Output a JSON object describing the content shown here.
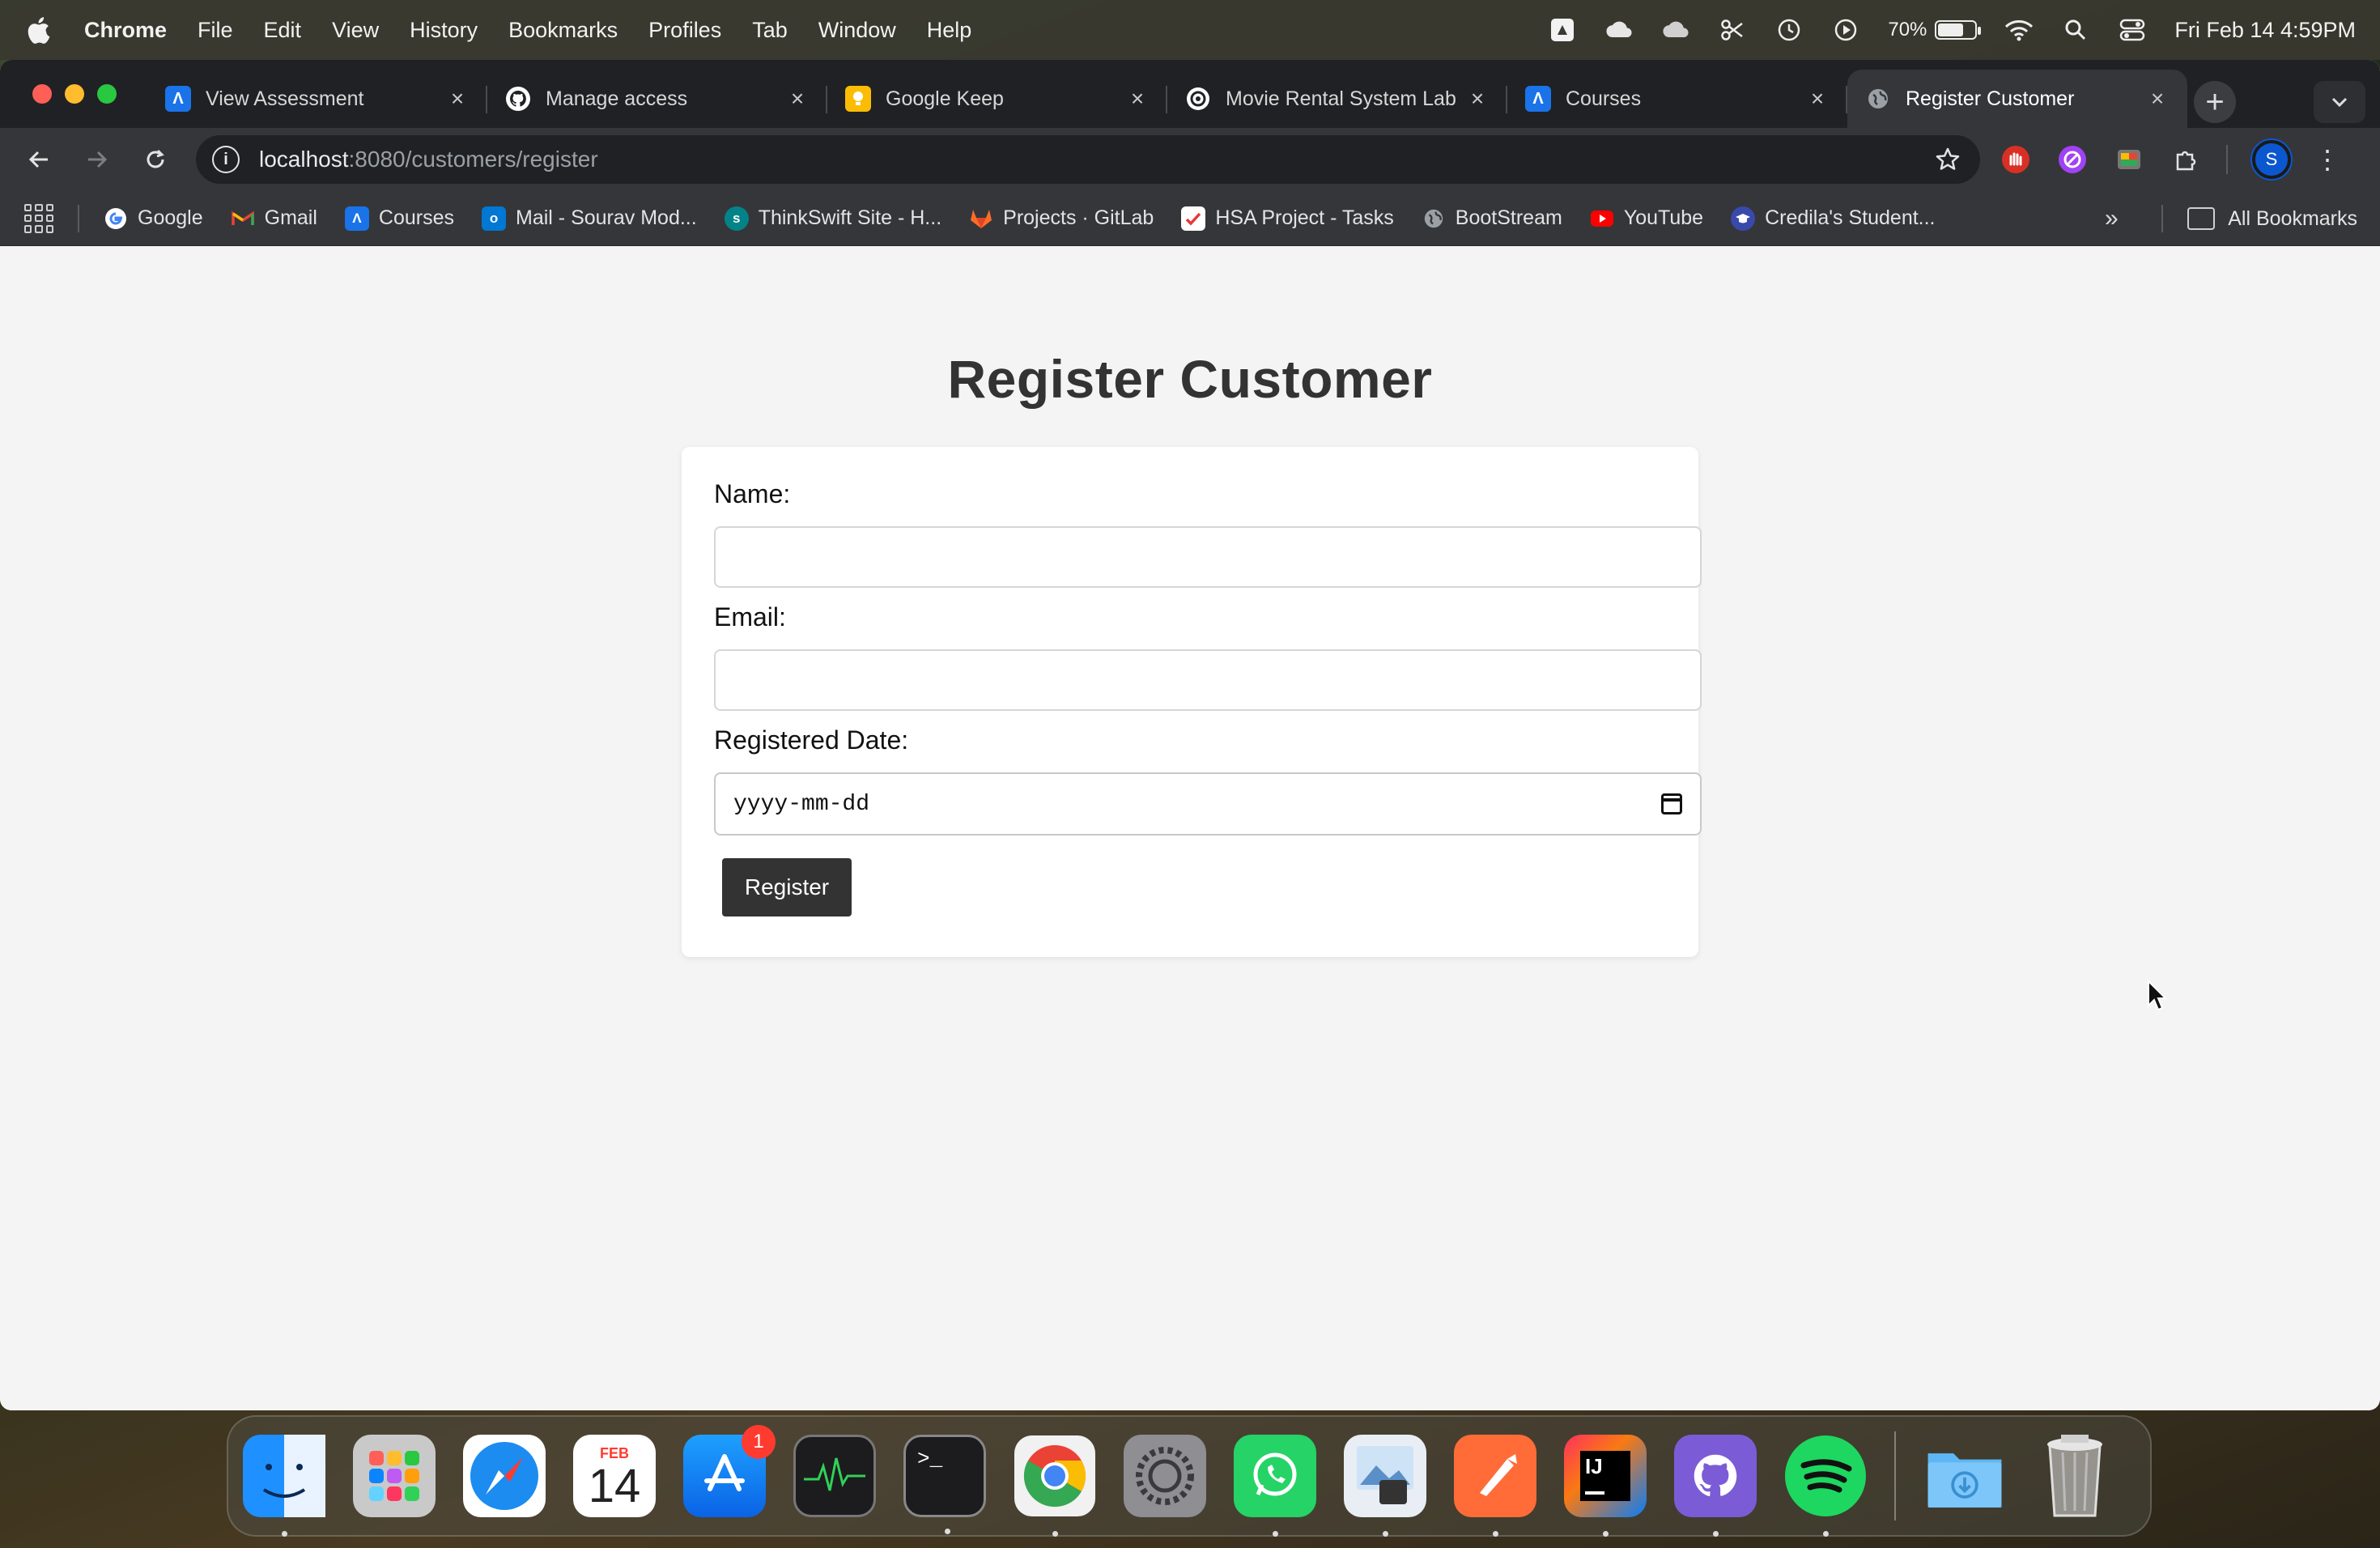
{
  "menubar": {
    "app_name": "Chrome",
    "items": [
      "File",
      "Edit",
      "View",
      "History",
      "Bookmarks",
      "Profiles",
      "Tab",
      "Window",
      "Help"
    ],
    "battery_percent": "70%",
    "datetime": "Fri Feb 14  4:59PM"
  },
  "tabs": [
    {
      "title": "View Assessment",
      "icon": "assessment-icon",
      "color": "#1a73e8",
      "active": false
    },
    {
      "title": "Manage access",
      "icon": "github-icon",
      "color": "#ffffff",
      "active": false
    },
    {
      "title": "Google Keep",
      "icon": "keep-icon",
      "color": "#fbbc04",
      "active": false
    },
    {
      "title": "Movie Rental System Lab",
      "icon": "openai-icon",
      "color": "#ffffff",
      "active": false
    },
    {
      "title": "Courses",
      "icon": "courses-icon",
      "color": "#1a73e8",
      "active": false
    },
    {
      "title": "Register Customer",
      "icon": "globe-icon",
      "color": "#9aa0a6",
      "active": true
    }
  ],
  "address_bar": {
    "host": "localhost",
    "path": ":8080/customers/register"
  },
  "profile_initial": "S",
  "bookmarks": [
    {
      "label": "Google",
      "icon": "google-icon",
      "color": "#4285f4"
    },
    {
      "label": "Gmail",
      "icon": "gmail-icon",
      "color": "#ea4335"
    },
    {
      "label": "Courses",
      "icon": "courses-icon",
      "color": "#1a73e8"
    },
    {
      "label": "Mail - Sourav Mod...",
      "icon": "outlook-icon",
      "color": "#0078d4"
    },
    {
      "label": "ThinkSwift Site - H...",
      "icon": "sharepoint-icon",
      "color": "#038387"
    },
    {
      "label": "Projects · GitLab",
      "icon": "gitlab-icon",
      "color": "#fc6d26"
    },
    {
      "label": "HSA Project - Tasks",
      "icon": "tasks-icon",
      "color": "#e53935"
    },
    {
      "label": "BootStream",
      "icon": "globe-icon",
      "color": "#9aa0a6"
    },
    {
      "label": "YouTube",
      "icon": "youtube-icon",
      "color": "#ff0000"
    },
    {
      "label": "Credila's Student...",
      "icon": "credila-icon",
      "color": "#3949ab"
    }
  ],
  "all_bookmarks_label": "All Bookmarks",
  "page": {
    "title": "Register Customer",
    "form": {
      "name_label": "Name:",
      "name_value": "",
      "email_label": "Email:",
      "email_value": "",
      "date_label": "Registered Date:",
      "date_placeholder": "yyyy-mm-dd",
      "submit_label": "Register"
    }
  },
  "dock": {
    "calendar_month": "FEB",
    "calendar_day": "14",
    "appstore_badge": "1",
    "apps": [
      "finder",
      "launchpad",
      "safari",
      "calendar",
      "app-store",
      "activity-monitor",
      "terminal",
      "chrome",
      "system-settings",
      "whatsapp",
      "preview",
      "postman",
      "intellij",
      "github-desktop",
      "spotify",
      "downloads",
      "trash"
    ]
  }
}
